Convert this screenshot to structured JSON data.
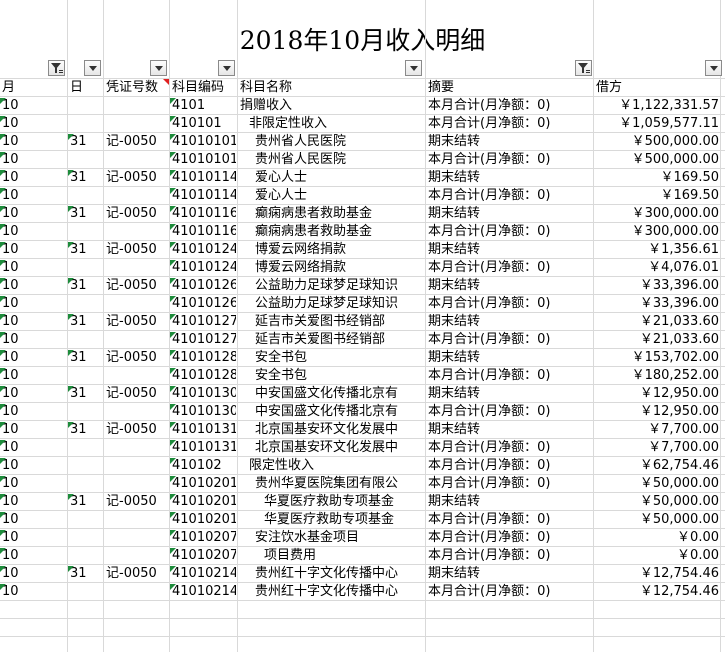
{
  "sheet": {
    "title": "2018年10月收入明细",
    "headers": {
      "month": "月",
      "day": "日",
      "voucher": "凭证号数",
      "code": "科目编码",
      "name": "科目名称",
      "summary": "摘要",
      "debit": "借方"
    },
    "filters": {
      "month_filter": "funnel-icon",
      "day_filter": "chevron-down-icon",
      "voucher_filter": "chevron-down-icon",
      "code_filter": "chevron-down-icon",
      "name_filter": "chevron-down-icon",
      "summary_filter": "funnel-icon",
      "debit_filter": "chevron-down-icon"
    },
    "colors": {
      "grid": "#d9d9d9",
      "error_indicator": "#1e8c3c",
      "comment_indicator": "#e02020"
    },
    "rows": [
      {
        "month": "10",
        "day": "",
        "voucher": "",
        "code": "4101",
        "name": "捐赠收入",
        "summary": "本月合计(月净额：0)",
        "debit": "￥1,122,331.57",
        "indent": 0
      },
      {
        "month": "10",
        "day": "",
        "voucher": "",
        "code": "410101",
        "name": "非限定性收入",
        "summary": "本月合计(月净额：0)",
        "debit": "￥1,059,577.11",
        "indent": 1
      },
      {
        "month": "10",
        "day": "31",
        "voucher": "记-0050",
        "code": "41010101",
        "name": "贵州省人民医院",
        "summary": "期末结转",
        "debit": "￥500,000.00",
        "indent": 2
      },
      {
        "month": "10",
        "day": "",
        "voucher": "",
        "code": "41010101",
        "name": "贵州省人民医院",
        "summary": "本月合计(月净额：0)",
        "debit": "￥500,000.00",
        "indent": 2
      },
      {
        "month": "10",
        "day": "31",
        "voucher": "记-0050",
        "code": "41010114",
        "name": "爱心人士",
        "summary": "期末结转",
        "debit": "￥169.50",
        "indent": 2
      },
      {
        "month": "10",
        "day": "",
        "voucher": "",
        "code": "41010114",
        "name": "爱心人士",
        "summary": "本月合计(月净额：0)",
        "debit": "￥169.50",
        "indent": 2
      },
      {
        "month": "10",
        "day": "31",
        "voucher": "记-0050",
        "code": "41010116",
        "name": "癫痫病患者救助基金",
        "summary": "期末结转",
        "debit": "￥300,000.00",
        "indent": 2
      },
      {
        "month": "10",
        "day": "",
        "voucher": "",
        "code": "41010116",
        "name": "癫痫病患者救助基金",
        "summary": "本月合计(月净额：0)",
        "debit": "￥300,000.00",
        "indent": 2
      },
      {
        "month": "10",
        "day": "31",
        "voucher": "记-0050",
        "code": "41010124",
        "name": "博爱云网络捐款",
        "summary": "期末结转",
        "debit": "￥1,356.61",
        "indent": 2
      },
      {
        "month": "10",
        "day": "",
        "voucher": "",
        "code": "41010124",
        "name": "博爱云网络捐款",
        "summary": "本月合计(月净额：0)",
        "debit": "￥4,076.01",
        "indent": 2
      },
      {
        "month": "10",
        "day": "31",
        "voucher": "记-0050",
        "code": "41010126",
        "name": "公益助力足球梦足球知识",
        "summary": "期末结转",
        "debit": "￥33,396.00",
        "indent": 2
      },
      {
        "month": "10",
        "day": "",
        "voucher": "",
        "code": "41010126",
        "name": "公益助力足球梦足球知识",
        "summary": "本月合计(月净额：0)",
        "debit": "￥33,396.00",
        "indent": 2
      },
      {
        "month": "10",
        "day": "31",
        "voucher": "记-0050",
        "code": "41010127",
        "name": "延吉市关爱图书经销部",
        "summary": "期末结转",
        "debit": "￥21,033.60",
        "indent": 2
      },
      {
        "month": "10",
        "day": "",
        "voucher": "",
        "code": "41010127",
        "name": "延吉市关爱图书经销部",
        "summary": "本月合计(月净额：0)",
        "debit": "￥21,033.60",
        "indent": 2
      },
      {
        "month": "10",
        "day": "31",
        "voucher": "记-0050",
        "code": "41010128",
        "name": "安全书包",
        "summary": "期末结转",
        "debit": "￥153,702.00",
        "indent": 2
      },
      {
        "month": "10",
        "day": "",
        "voucher": "",
        "code": "41010128",
        "name": "安全书包",
        "summary": "本月合计(月净额：0)",
        "debit": "￥180,252.00",
        "indent": 2
      },
      {
        "month": "10",
        "day": "31",
        "voucher": "记-0050",
        "code": "41010130",
        "name": "中安国盛文化传播北京有",
        "summary": "期末结转",
        "debit": "￥12,950.00",
        "indent": 2
      },
      {
        "month": "10",
        "day": "",
        "voucher": "",
        "code": "41010130",
        "name": "中安国盛文化传播北京有",
        "summary": "本月合计(月净额：0)",
        "debit": "￥12,950.00",
        "indent": 2
      },
      {
        "month": "10",
        "day": "31",
        "voucher": "记-0050",
        "code": "41010131",
        "name": "北京国基安环文化发展中",
        "summary": "期末结转",
        "debit": "￥7,700.00",
        "indent": 2
      },
      {
        "month": "10",
        "day": "",
        "voucher": "",
        "code": "41010131",
        "name": "北京国基安环文化发展中",
        "summary": "本月合计(月净额：0)",
        "debit": "￥7,700.00",
        "indent": 2
      },
      {
        "month": "10",
        "day": "",
        "voucher": "",
        "code": "410102",
        "name": "限定性收入",
        "summary": "本月合计(月净额：0)",
        "debit": "￥62,754.46",
        "indent": 1
      },
      {
        "month": "10",
        "day": "",
        "voucher": "",
        "code": "41010201",
        "name": "贵州华夏医院集团有限公",
        "summary": "本月合计(月净额：0)",
        "debit": "￥50,000.00",
        "indent": 2
      },
      {
        "month": "10",
        "day": "31",
        "voucher": "记-0050",
        "code": "41010201",
        "name": "华夏医疗救助专项基金",
        "summary": "期末结转",
        "debit": "￥50,000.00",
        "indent": 3
      },
      {
        "month": "10",
        "day": "",
        "voucher": "",
        "code": "41010201",
        "name": "华夏医疗救助专项基金",
        "summary": "本月合计(月净额：0)",
        "debit": "￥50,000.00",
        "indent": 3
      },
      {
        "month": "10",
        "day": "",
        "voucher": "",
        "code": "41010207",
        "name": "安注饮水基金项目",
        "summary": "本月合计(月净额：0)",
        "debit": "￥0.00",
        "indent": 2
      },
      {
        "month": "10",
        "day": "",
        "voucher": "",
        "code": "41010207",
        "name": "项目费用",
        "summary": "本月合计(月净额：0)",
        "debit": "￥0.00",
        "indent": 3
      },
      {
        "month": "10",
        "day": "31",
        "voucher": "记-0050",
        "code": "41010214",
        "name": "贵州红十字文化传播中心",
        "summary": "期末结转",
        "debit": "￥12,754.46",
        "indent": 2
      },
      {
        "month": "10",
        "day": "",
        "voucher": "",
        "code": "41010214",
        "name": "贵州红十字文化传播中心",
        "summary": "本月合计(月净额：0)",
        "debit": "￥12,754.46",
        "indent": 2
      }
    ]
  }
}
